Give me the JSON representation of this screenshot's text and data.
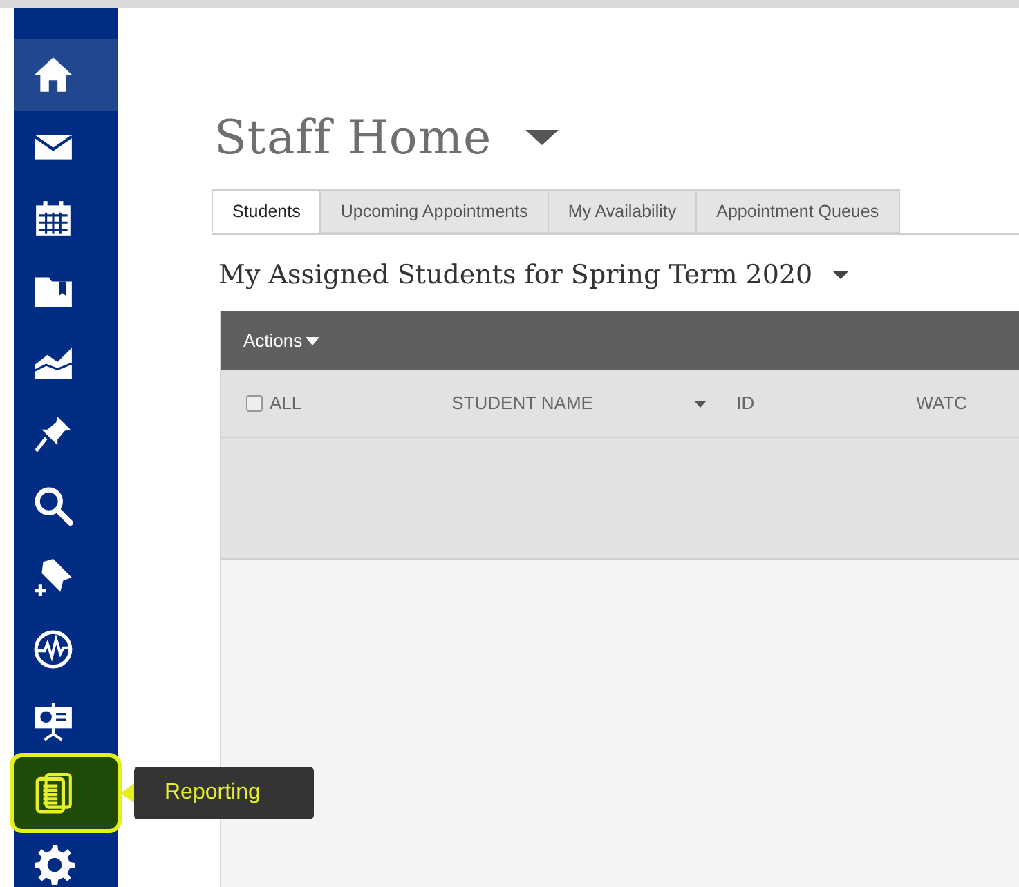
{
  "sidebar": {
    "items": [
      {
        "selected": true,
        "highlighted": false
      },
      {
        "selected": false,
        "highlighted": false
      },
      {
        "selected": false,
        "highlighted": false
      },
      {
        "selected": false,
        "highlighted": false
      },
      {
        "selected": false,
        "highlighted": false
      },
      {
        "selected": false,
        "highlighted": false
      },
      {
        "selected": false,
        "highlighted": false
      },
      {
        "selected": false,
        "highlighted": false
      },
      {
        "selected": false,
        "highlighted": false
      },
      {
        "selected": false,
        "highlighted": false
      },
      {
        "selected": false,
        "highlighted": true
      },
      {
        "selected": false,
        "highlighted": false
      }
    ],
    "tooltip": "Reporting"
  },
  "page": {
    "title": "Staff Home"
  },
  "tabs": [
    {
      "label": "Students",
      "selected": true
    },
    {
      "label": "Upcoming Appointments",
      "selected": false
    },
    {
      "label": "My Availability",
      "selected": false
    },
    {
      "label": "Appointment Queues",
      "selected": false
    }
  ],
  "section_title": "My Assigned Students for Spring Term 2020",
  "table": {
    "actions": "Actions",
    "select_all": {
      "label": "ALL",
      "checked": false
    },
    "columns": [
      {
        "label": "STUDENT NAME",
        "sortable": true
      },
      {
        "label": "ID",
        "sortable": false
      },
      {
        "label": "WATC",
        "sortable": false
      }
    ]
  }
}
